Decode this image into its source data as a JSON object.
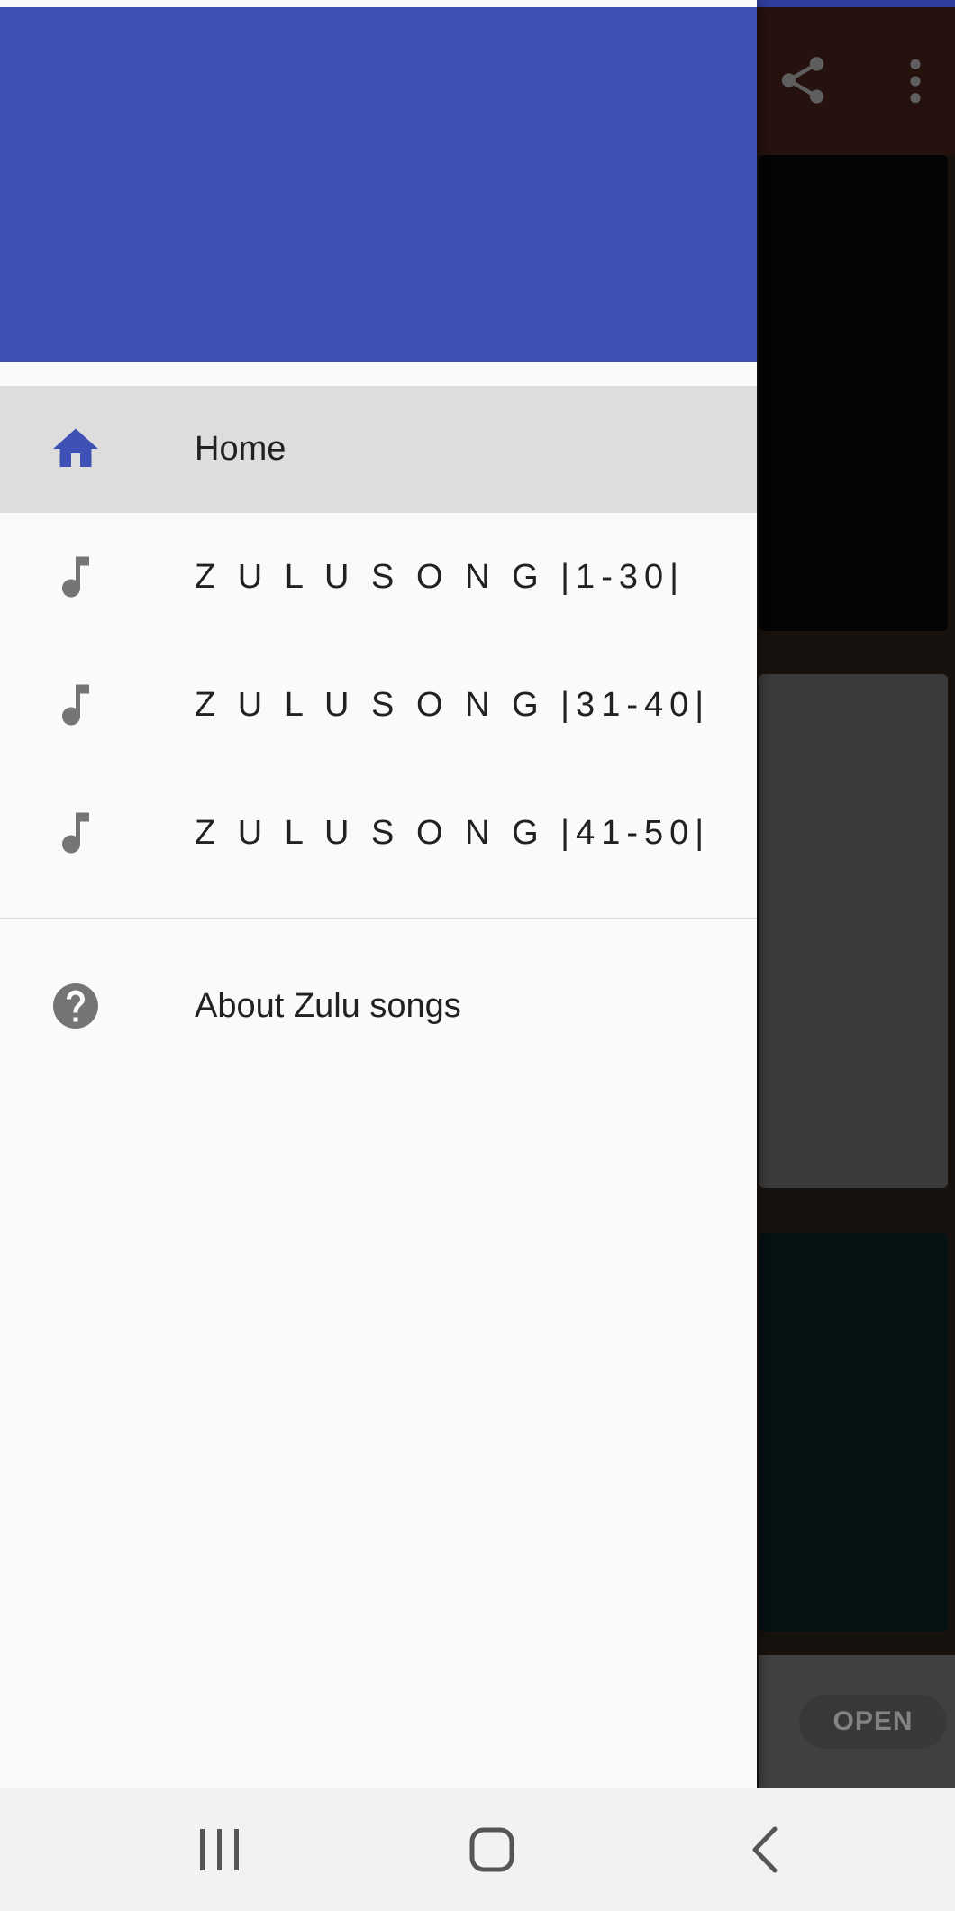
{
  "app": {
    "toolbar_icons": [
      "share-icon",
      "more-vert-icon"
    ],
    "ad": {
      "open_label": "OPEN"
    }
  },
  "drawer": {
    "header_color": "#3f51b5",
    "items": [
      {
        "label": "Home",
        "icon": "home-icon",
        "selected": true
      },
      {
        "label": "Z U L U   S O N G |1-30|",
        "icon": "music-note-icon",
        "selected": false
      },
      {
        "label": "Z U L U   S O N G |31-40|",
        "icon": "music-note-icon",
        "selected": false
      },
      {
        "label": "Z U L U   S O N G |41-50|",
        "icon": "music-note-icon",
        "selected": false
      }
    ],
    "footer_items": [
      {
        "label": "About Zulu songs",
        "icon": "help-icon"
      }
    ]
  },
  "system_nav": {
    "buttons": [
      "recents-icon",
      "home-button-icon",
      "back-icon"
    ]
  },
  "colors": {
    "accent": "#3f51b5",
    "icon_gray": "#757575",
    "selected_bg": "#dddddd"
  }
}
